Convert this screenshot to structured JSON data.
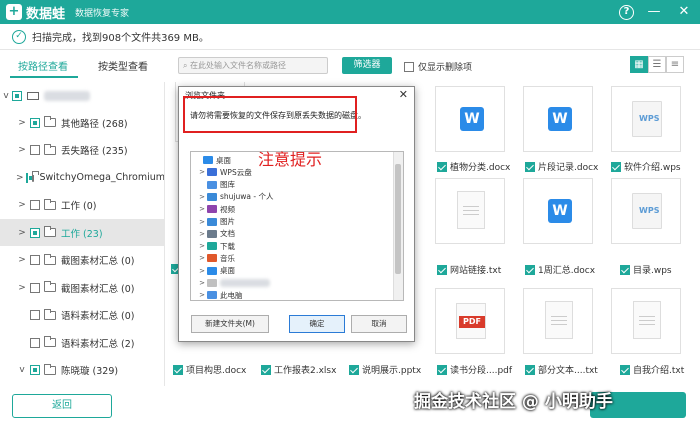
{
  "app": {
    "logo_mark": "+",
    "name": "数据蛙",
    "subtitle": "数据恢复专家"
  },
  "window_controls": {
    "help": "?",
    "minimize": "—",
    "close": "✕"
  },
  "status": {
    "text": "扫描完成，找到908个文件共369 MB。"
  },
  "tabs": {
    "by_path": "按路径查看",
    "by_type": "按类型查看"
  },
  "search": {
    "placeholder": "在此处输入文件名称或路径"
  },
  "filter_button": "筛选器",
  "only_deleted": "仅显示删除项",
  "tree": [
    {
      "label": "其他路径 (268)",
      "arrow": ">",
      "state": "partial"
    },
    {
      "label": "丢失路径 (235)",
      "arrow": ">",
      "state": "empty"
    },
    {
      "label": "SwitchyOmega_Chromium",
      "arrow": ">",
      "state": "partial"
    },
    {
      "label": "工作 (0)",
      "arrow": ">",
      "state": "empty"
    },
    {
      "label": "工作 (23)",
      "arrow": ">",
      "state": "partial"
    },
    {
      "label": "截图素材汇总 (0)",
      "arrow": ">",
      "state": "empty"
    },
    {
      "label": "截图素材汇总 (0)",
      "arrow": ">",
      "state": "empty"
    },
    {
      "label": "语料素材汇总 (0)",
      "arrow": "",
      "state": "empty"
    },
    {
      "label": "语料素材汇总 (2)",
      "arrow": "",
      "state": "empty"
    },
    {
      "label": "陈晓璇 (329)",
      "arrow": "v",
      "state": "partial"
    }
  ],
  "tree_root_arrow": "v",
  "grid": {
    "row1": [
      {
        "icon": "W",
        "name": "植物分类.docx"
      },
      {
        "icon": "W",
        "name": "片段记录.docx"
      },
      {
        "icon": "WPS",
        "name": "软件介绍.wps"
      }
    ],
    "row2": [
      {
        "icon": "",
        "name": "网站链接.txt"
      },
      {
        "icon": "W",
        "name": "1周汇总.docx"
      },
      {
        "icon": "WPS",
        "name": "目录.wps"
      }
    ],
    "row3": [
      {
        "icon": "PDF",
        "name": "读书分段....pdf"
      },
      {
        "icon": "",
        "name": "部分文本....txt"
      },
      {
        "icon": "",
        "name": "自我介绍.txt"
      }
    ],
    "bottom_names": [
      "项目构思.docx",
      "工作报表2.xlsx",
      "说明展示.pptx"
    ]
  },
  "dialog": {
    "title": "浏览文件夹",
    "close": "✕",
    "message": "请勿将需要恢复的文件保存到原丢失数据的磁盘。",
    "items": [
      {
        "label": "桌面",
        "caret": "",
        "color": "#2b8be8"
      },
      {
        "label": "WPS云盘",
        "caret": ">",
        "color": "#3a6fd8"
      },
      {
        "label": "图库",
        "caret": "",
        "color": "#4a90e2"
      },
      {
        "label": "shujuwa - 个人",
        "caret": ">",
        "color": "#3a8ad8"
      },
      {
        "label": "视频",
        "caret": ">",
        "color": "#8e44ad"
      },
      {
        "label": "图片",
        "caret": ">",
        "color": "#3a8ad8"
      },
      {
        "label": "文档",
        "caret": ">",
        "color": "#6b7b8c"
      },
      {
        "label": "下载",
        "caret": ">",
        "color": "#1ea89a"
      },
      {
        "label": "音乐",
        "caret": ">",
        "color": "#e0582b"
      },
      {
        "label": "桌面",
        "caret": ">",
        "color": "#2b8be8"
      },
      {
        "label": "",
        "caret": ">",
        "color": "#c0c0c0"
      },
      {
        "label": "此电脑",
        "caret": ">",
        "color": "#4a90e2"
      }
    ],
    "new_folder": "新建文件夹(M)",
    "ok": "确定",
    "cancel": "取消"
  },
  "annotation": "注意提示",
  "back_button": "返回",
  "watermark": "掘金技术社区 @ 小明助手"
}
